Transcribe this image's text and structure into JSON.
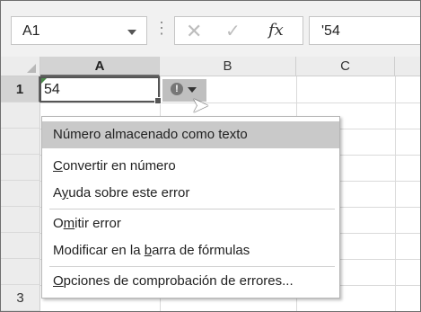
{
  "name_box": {
    "value": "A1"
  },
  "formula_bar": {
    "separator": "⋮",
    "cancel_glyph": "✕",
    "enter_glyph": "✓",
    "fx_label": "fx",
    "value": "'54"
  },
  "grid": {
    "columns": [
      "A",
      "B",
      "C"
    ],
    "rows": [
      "1"
    ],
    "active_cell_value": "54"
  },
  "smart_tag": {
    "icon": "warning-icon",
    "glyph": "!"
  },
  "context_menu": {
    "header": "Número almacenado como texto",
    "items": [
      {
        "pre": "",
        "accel": "C",
        "post": "onvertir en número"
      },
      {
        "pre": "A",
        "accel": "y",
        "post": "uda sobre este error"
      },
      {
        "pre": "O",
        "accel": "m",
        "post": "itir error"
      },
      {
        "pre": "Modificar en la ",
        "accel": "b",
        "post": "arra de fórmulas"
      },
      {
        "pre": "",
        "accel": "O",
        "post": "pciones de comprobación de errores..."
      }
    ]
  },
  "partial_row_label": "3"
}
